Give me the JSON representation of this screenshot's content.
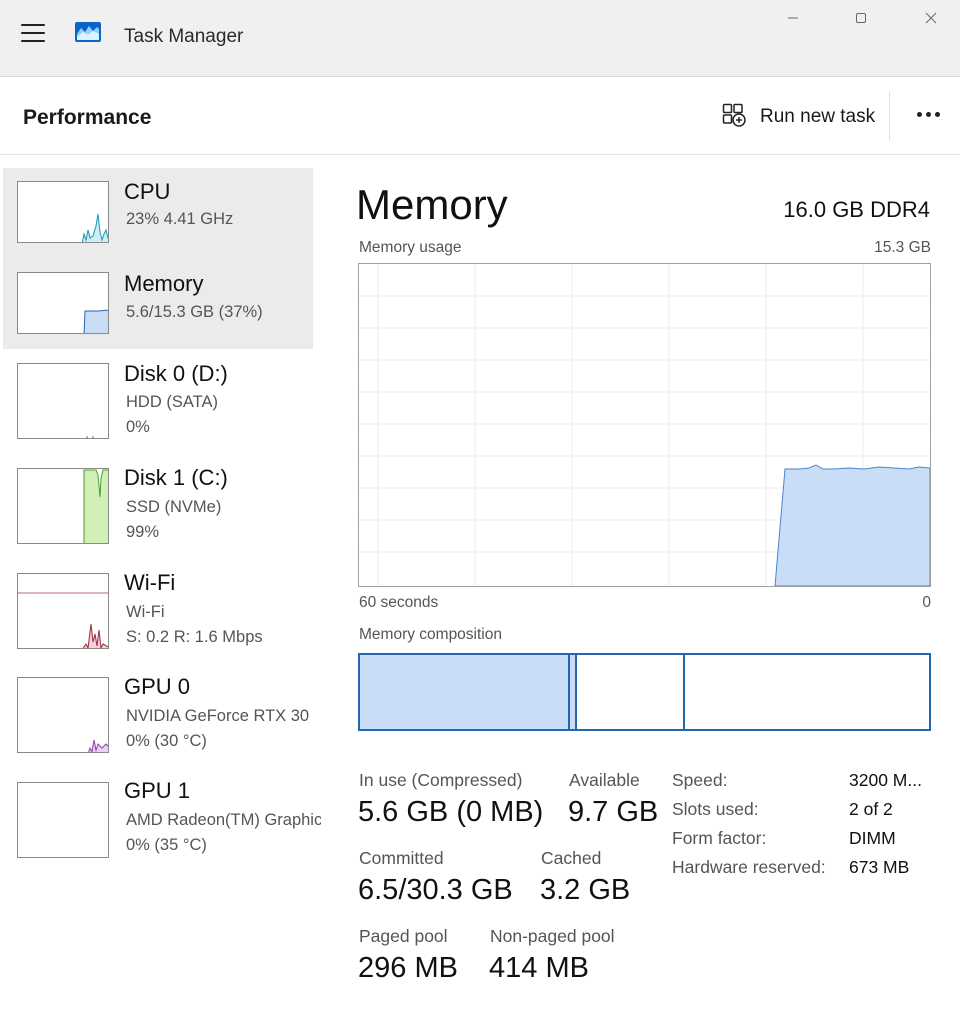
{
  "window": {
    "title": "Task Manager"
  },
  "header": {
    "title": "Performance",
    "run_new_task": "Run new task"
  },
  "sidebar": {
    "items": [
      {
        "name": "CPU",
        "sub1": "23%  4.41 GHz",
        "sub2": "",
        "color": "#1797b8",
        "selected": true
      },
      {
        "name": "Memory",
        "sub1": "5.6/15.3 GB (37%)",
        "sub2": "",
        "color": "#2166b2",
        "selected": true
      },
      {
        "name": "Disk 0 (D:)",
        "sub1": "HDD (SATA)",
        "sub2": "0%",
        "color": "#4c9a2a",
        "selected": false
      },
      {
        "name": "Disk 1 (C:)",
        "sub1": "SSD (NVMe)",
        "sub2": "99%",
        "color": "#4c9a2a",
        "selected": false
      },
      {
        "name": "Wi-Fi",
        "sub1": "Wi-Fi",
        "sub2": "S: 0.2  R: 1.6 Mbps",
        "color": "#a0263e",
        "selected": false
      },
      {
        "name": "GPU 0",
        "sub1": "NVIDIA GeForce RTX 30",
        "sub2": "0%  (30 °C)",
        "color": "#8a3fb0",
        "selected": false
      },
      {
        "name": "GPU 1",
        "sub1": "AMD Radeon(TM) Graphics",
        "sub2": "0%  (35 °C)",
        "color": "#8a3fb0",
        "selected": false
      }
    ]
  },
  "memory": {
    "title": "Memory",
    "spec": "16.0 GB DDR4",
    "usage_label": "Memory usage",
    "usage_max": "15.3 GB",
    "axis_left": "60 seconds",
    "axis_right": "0",
    "composition_label": "Memory composition",
    "composition": {
      "in_use_fraction": 0.366,
      "modified_fraction": 0.016,
      "standby_fraction": 0.19,
      "free_fraction": 0.428
    },
    "usage_series_fraction": 0.37,
    "stats": {
      "in_use_label": "In use (Compressed)",
      "in_use_value": "5.6 GB (0 MB)",
      "available_label": "Available",
      "available_value": "9.7 GB",
      "committed_label": "Committed",
      "committed_value": "6.5/30.3 GB",
      "cached_label": "Cached",
      "cached_value": "3.2 GB",
      "paged_label": "Paged pool",
      "paged_value": "296 MB",
      "nonpaged_label": "Non-paged pool",
      "nonpaged_value": "414 MB"
    },
    "details": {
      "speed_label": "Speed:",
      "speed_value": "3200 M...",
      "slots_label": "Slots used:",
      "slots_value": "2 of 2",
      "form_label": "Form factor:",
      "form_value": "DIMM",
      "reserved_label": "Hardware reserved:",
      "reserved_value": "673 MB"
    }
  },
  "colors": {
    "memory_fill": "#c9ddf7",
    "memory_line": "#2166b2",
    "disk_fill": "#d3efb8",
    "cpu_line": "#1797b8"
  }
}
